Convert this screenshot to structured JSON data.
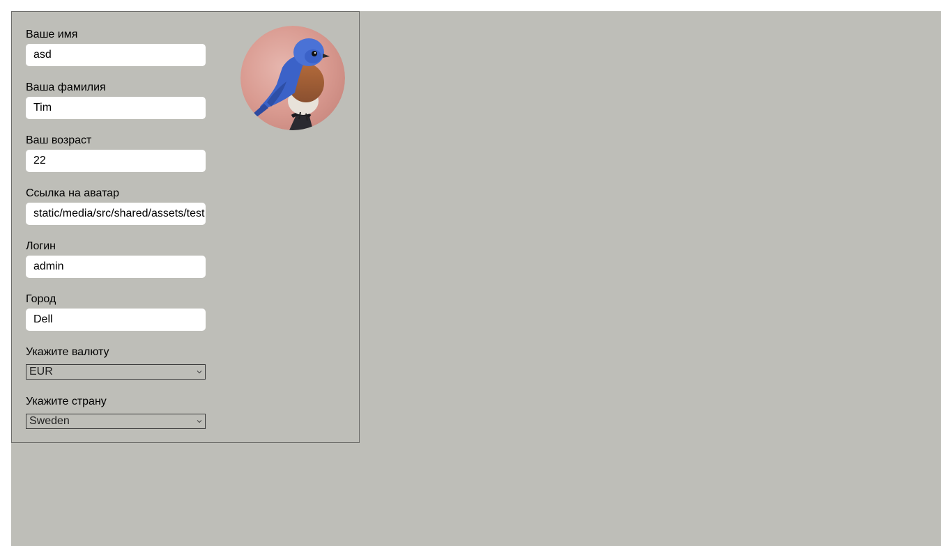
{
  "form": {
    "first_name": {
      "label": "Ваше имя",
      "value": "asd"
    },
    "last_name": {
      "label": "Ваша фамилия",
      "value": "Tim"
    },
    "age": {
      "label": "Ваш возраст",
      "value": "22"
    },
    "avatar_link": {
      "label": "Ссылка на аватар",
      "value": "static/media/src/shared/assets/test"
    },
    "login": {
      "label": "Логин",
      "value": "admin"
    },
    "city": {
      "label": "Город",
      "value": "Dell"
    },
    "currency": {
      "label": "Укажите валюту",
      "selected": "EUR"
    },
    "country": {
      "label": "Укажите страну",
      "selected": "Sweden"
    }
  },
  "avatar": {
    "icon": "bluebird-avatar-icon"
  },
  "colors": {
    "page_background": "#bebeb8",
    "card_border": "#6d6d6a",
    "input_background": "#ffffff"
  }
}
